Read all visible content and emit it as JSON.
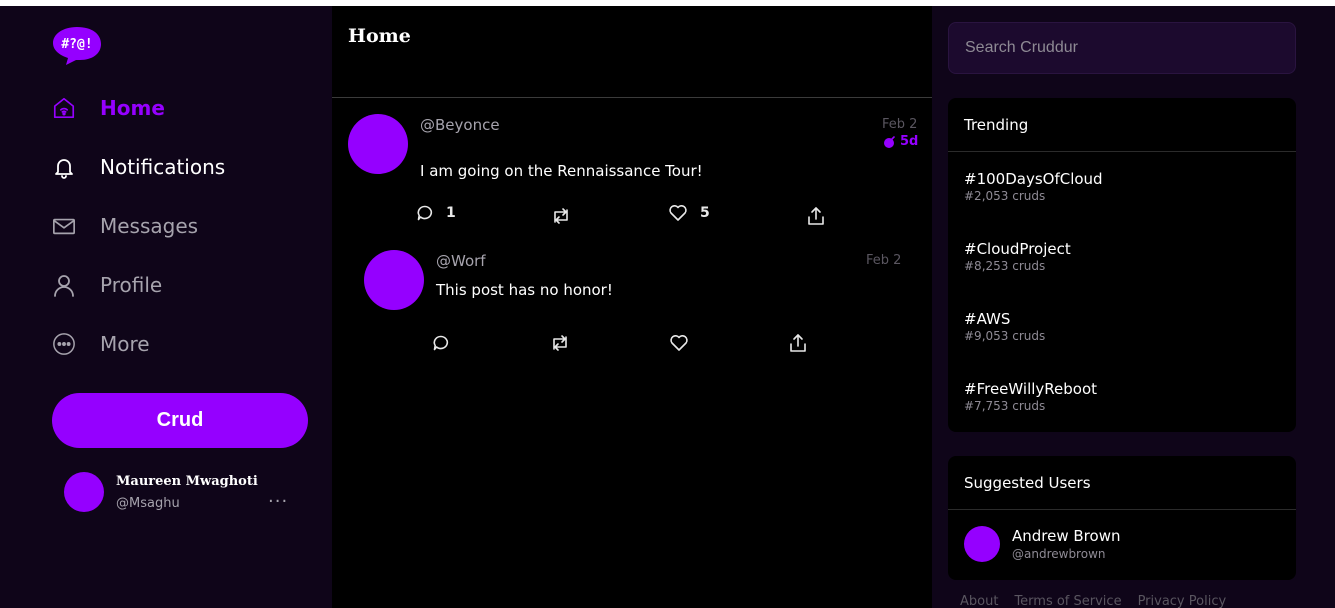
{
  "logo": {
    "text": "#?@!"
  },
  "nav": {
    "items": [
      {
        "label": "Home",
        "icon": "home-icon"
      },
      {
        "label": "Notifications",
        "icon": "bell-icon"
      },
      {
        "label": "Messages",
        "icon": "mail-icon"
      },
      {
        "label": "Profile",
        "icon": "user-icon"
      },
      {
        "label": "More",
        "icon": "more-icon"
      }
    ],
    "crud_label": "Crud"
  },
  "current_user": {
    "name": "Maureen Mwaghoti",
    "handle": "@Msaghu",
    "menu": "..."
  },
  "feed": {
    "title": "Home",
    "posts": [
      {
        "handle": "@Beyonce",
        "date": "Feb 2",
        "expires": "5d",
        "text": "I am going on the Rennaissance Tour!",
        "replies": "1",
        "likes": "5"
      },
      {
        "handle": "@Worf",
        "date": "Feb 2",
        "text": "This post has no honor!"
      }
    ]
  },
  "search": {
    "placeholder": "Search Cruddur"
  },
  "trending": {
    "title": "Trending",
    "items": [
      {
        "tag": "#100DaysOfCloud",
        "count": "#2,053 cruds"
      },
      {
        "tag": "#CloudProject",
        "count": "#8,253 cruds"
      },
      {
        "tag": "#AWS",
        "count": "#9,053 cruds"
      },
      {
        "tag": "#FreeWillyReboot",
        "count": "#7,753 cruds"
      }
    ]
  },
  "suggested": {
    "title": "Suggested Users",
    "users": [
      {
        "name": "Andrew Brown",
        "handle": "@andrewbrown"
      }
    ]
  },
  "footer": {
    "links": [
      "About",
      "Terms of Service",
      "Privacy Policy"
    ]
  },
  "colors": {
    "accent": "#9500ff",
    "sidebar_bg": "#0f0519",
    "feed_bg": "#000000"
  }
}
